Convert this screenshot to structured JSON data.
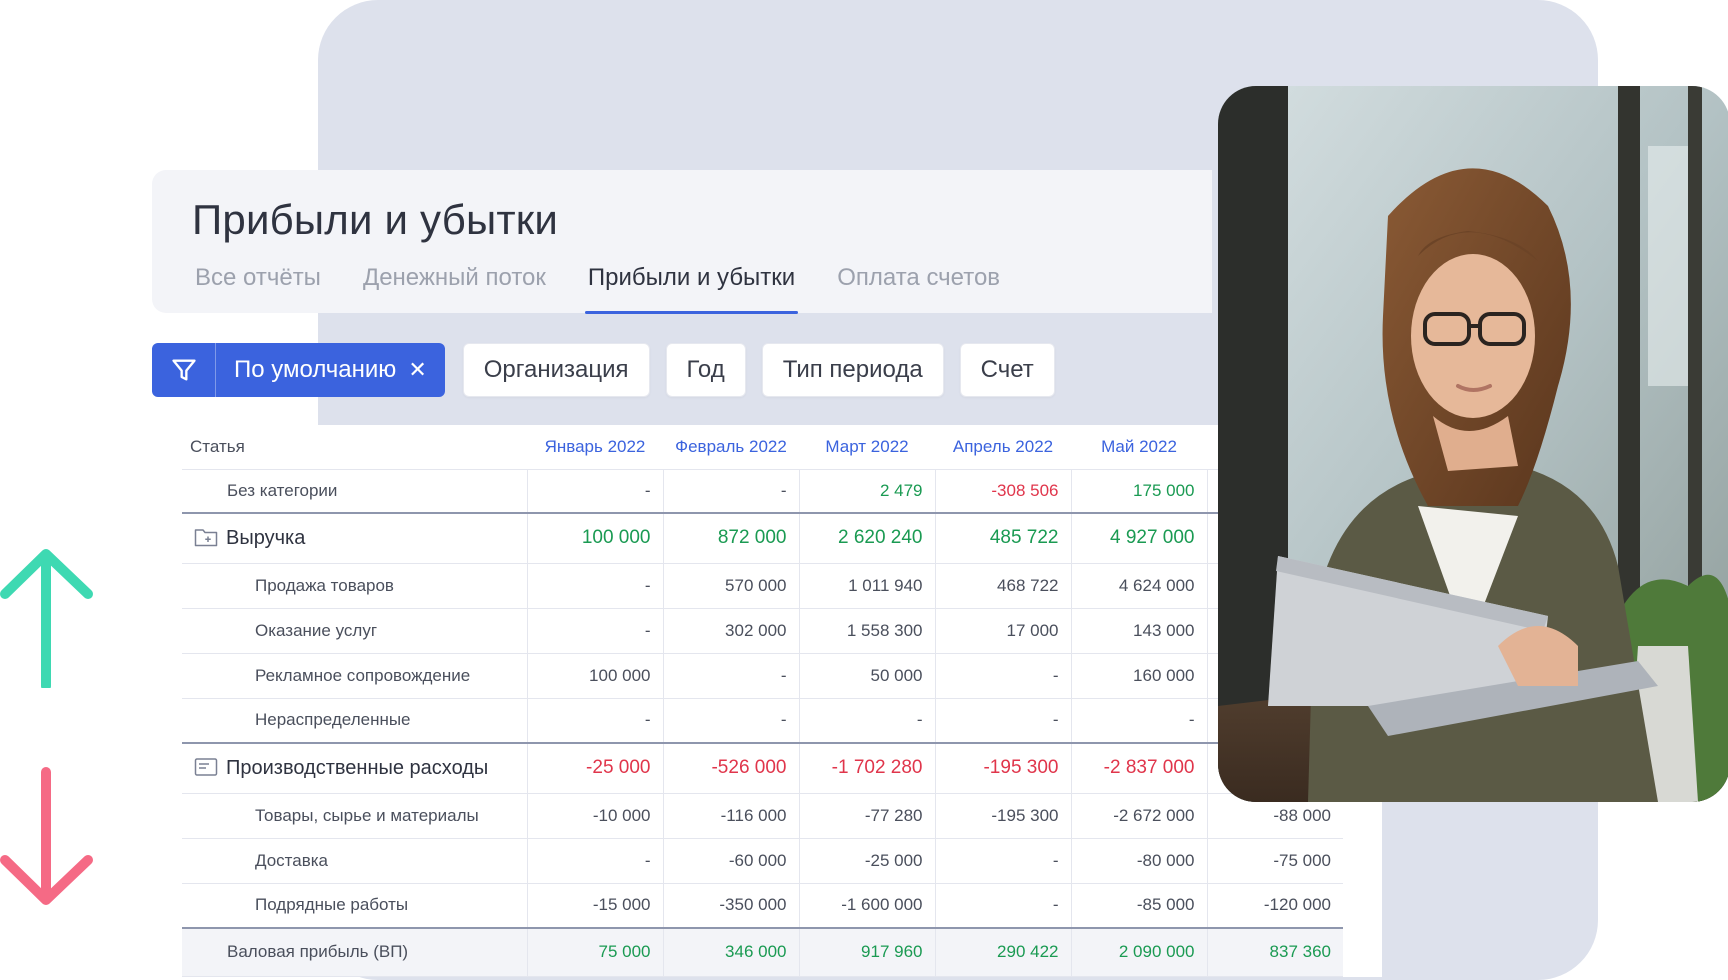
{
  "header": {
    "title": "Прибыли и убытки",
    "tabs": [
      {
        "label": "Все отчёты",
        "active": false
      },
      {
        "label": "Денежный поток",
        "active": false
      },
      {
        "label": "Прибыли и убытки",
        "active": true
      },
      {
        "label": "Оплата счетов",
        "active": false
      }
    ]
  },
  "filters": {
    "default_label": "По умолчанию",
    "clear_symbol": "✕",
    "chips": [
      "Организация",
      "Год",
      "Тип периода",
      "Счет"
    ]
  },
  "table": {
    "header_first": "Статья",
    "months": [
      "Январь 2022",
      "Февраль 2022",
      "Март 2022",
      "Апрель 2022",
      "Май 2022",
      ""
    ],
    "rows": {
      "uncat": {
        "name": "Без категории",
        "values": [
          "-",
          "-",
          "2 479",
          "-308 506",
          "175 000",
          ""
        ]
      },
      "revenue": {
        "name": "Выручка",
        "values": [
          "100 000",
          "872 000",
          "2 620 240",
          "485 722",
          "4 927 000",
          ""
        ]
      },
      "sales": {
        "name": "Продажа товаров",
        "values": [
          "-",
          "570 000",
          "1 011 940",
          "468 722",
          "4 624 000",
          ""
        ]
      },
      "services": {
        "name": "Оказание услуг",
        "values": [
          "-",
          "302 000",
          "1 558 300",
          "17 000",
          "143 000",
          ""
        ]
      },
      "ads": {
        "name": "Рекламное сопровождение",
        "values": [
          "100 000",
          "-",
          "50 000",
          "-",
          "160 000",
          ""
        ]
      },
      "unalloc": {
        "name": "Нераспределенные",
        "values": [
          "-",
          "-",
          "-",
          "-",
          "-",
          ""
        ]
      },
      "prod": {
        "name": "Производственные расходы",
        "values": [
          "-25 000",
          "-526 000",
          "-1 702 280",
          "-195 300",
          "-2 837 000",
          ""
        ]
      },
      "goods": {
        "name": "Товары, сырье и материалы",
        "values": [
          "-10 000",
          "-116 000",
          "-77 280",
          "-195 300",
          "-2 672 000",
          "-88 000"
        ]
      },
      "delivery": {
        "name": "Доставка",
        "values": [
          "-",
          "-60 000",
          "-25 000",
          "-",
          "-80 000",
          "-75 000"
        ]
      },
      "contract": {
        "name": "Подрядные работы",
        "values": [
          "-15 000",
          "-350 000",
          "-1 600 000",
          "-",
          "-85 000",
          "-120 000"
        ]
      },
      "gross": {
        "name": "Валовая прибыль (ВП)",
        "values": [
          "75 000",
          "346 000",
          "917 960",
          "290 422",
          "2 090 000",
          "837 360"
        ]
      }
    }
  },
  "colors": {
    "accent": "#3b63de",
    "positive": "#1a9a52",
    "negative": "#e0354b",
    "arrow_up": "#3ed9b2",
    "arrow_down": "#f56a85"
  },
  "icons": {
    "filter": "filter-funnel-icon",
    "revenue": "folder-plus-icon",
    "expense": "document-list-icon",
    "arrow_up": "arrow-up-icon",
    "arrow_down": "arrow-down-icon"
  }
}
